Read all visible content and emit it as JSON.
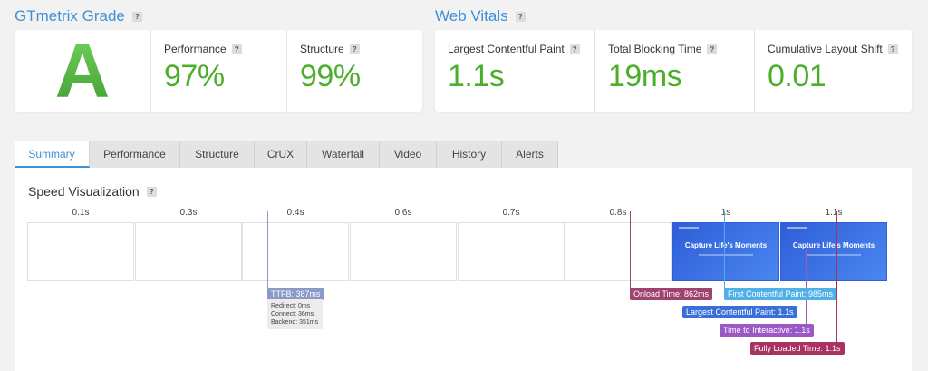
{
  "grade_section": {
    "title": "GTmetrix Grade",
    "grade": "A",
    "help": "?"
  },
  "metrics": [
    {
      "label": "Performance",
      "value": "97%"
    },
    {
      "label": "Structure",
      "value": "99%"
    }
  ],
  "vitals_section": {
    "title": "Web Vitals",
    "help": "?"
  },
  "vitals": [
    {
      "label": "Largest Contentful Paint",
      "value": "1.1s"
    },
    {
      "label": "Total Blocking Time",
      "value": "19ms"
    },
    {
      "label": "Cumulative Layout Shift",
      "value": "0.01"
    }
  ],
  "tabs": [
    "Summary",
    "Performance",
    "Structure",
    "CrUX",
    "Waterfall",
    "Video",
    "History",
    "Alerts"
  ],
  "speed": {
    "title": "Speed Visualization",
    "times": [
      "0.1s",
      "0.3s",
      "0.4s",
      "0.6s",
      "0.7s",
      "0.8s",
      "1s",
      "1.1s"
    ],
    "screenshot_title": "Capture Life's Moments",
    "markers": {
      "ttfb": "TTFB: 387ms",
      "onload": "Onload Time: 862ms",
      "fcp": "First Contentful Paint: 985ms",
      "lcp": "Largest Contentful Paint: 1.1s",
      "tti": "Time to Interactive: 1.1s",
      "fully_loaded": "Fully Loaded Time: 1.1s"
    },
    "ttfb_details": {
      "redirect": "Redirect: 0ms",
      "connect": "Connect: 36ms",
      "backend": "Backend: 351ms"
    }
  },
  "colors": {
    "accent": "#3f90d6",
    "good": "#4caf2a",
    "ttfb": "#8a9ac8",
    "onload": "#a0426e",
    "fcp": "#4fb0e8",
    "lcp": "#3a6fd8",
    "tti": "#9b59c6",
    "fully_loaded": "#a83262"
  }
}
